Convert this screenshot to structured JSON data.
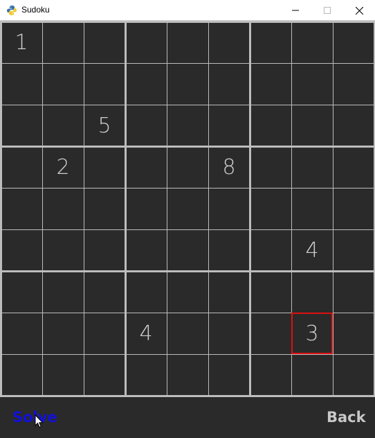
{
  "window": {
    "title": "Sudoku",
    "minimize_glyph": "—",
    "maximize_glyph": "☐",
    "close_glyph": "✕",
    "app_icon": "python-icon"
  },
  "board": {
    "givens": [
      {
        "row": 0,
        "col": 0,
        "value": "1"
      },
      {
        "row": 2,
        "col": 2,
        "value": "5"
      },
      {
        "row": 3,
        "col": 1,
        "value": "2"
      },
      {
        "row": 3,
        "col": 5,
        "value": "8"
      },
      {
        "row": 5,
        "col": 7,
        "value": "4"
      },
      {
        "row": 7,
        "col": 3,
        "value": "4"
      },
      {
        "row": 7,
        "col": 7,
        "value": "3"
      }
    ],
    "selected": {
      "row": 7,
      "col": 7
    },
    "colors": {
      "background": "#2a2a2a",
      "grid": "#bdbdbd",
      "digit": "#cfcfcf",
      "selection": "#e01010"
    }
  },
  "buttons": {
    "solve_label": "Solve",
    "back_label": "Back",
    "solve_color": "#1010dd",
    "back_color": "#c8c8c8"
  }
}
